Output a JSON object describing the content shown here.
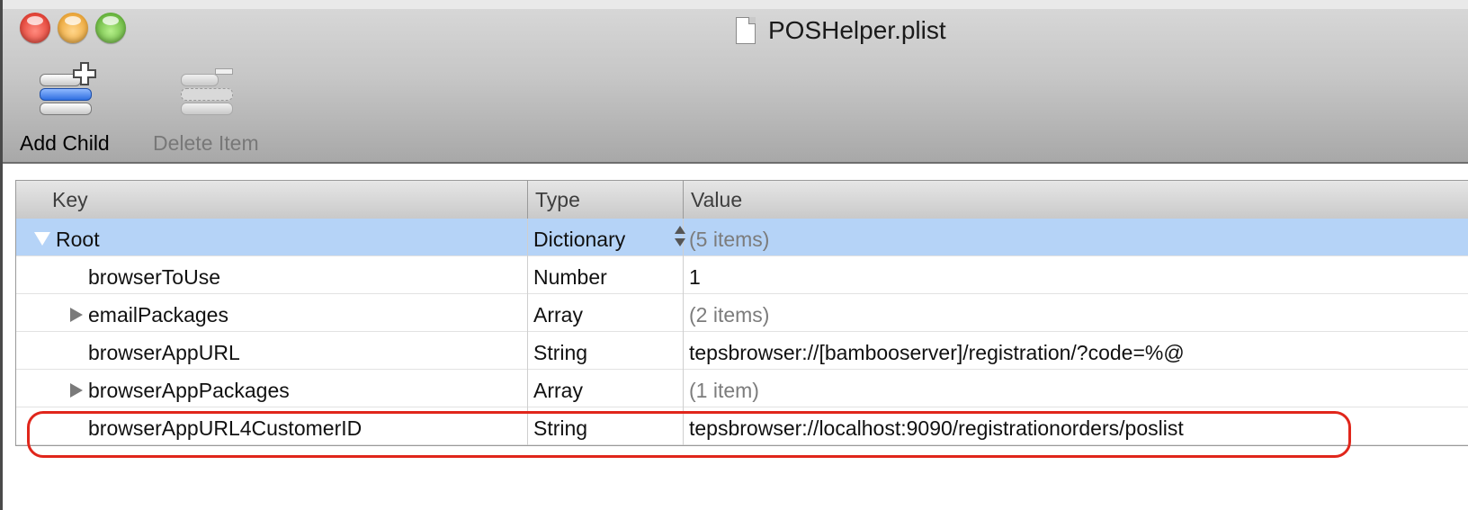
{
  "window": {
    "title": "POSHelper.plist"
  },
  "toolbar": {
    "add_child_label": "Add Child",
    "delete_item_label": "Delete Item"
  },
  "table": {
    "headers": {
      "key": "Key",
      "type": "Type",
      "value": "Value"
    },
    "rows": [
      {
        "key": "Root",
        "type": "Dictionary",
        "value": "(5 items)"
      },
      {
        "key": "browserToUse",
        "type": "Number",
        "value": "1"
      },
      {
        "key": "emailPackages",
        "type": "Array",
        "value": "(2 items)"
      },
      {
        "key": "browserAppURL",
        "type": "String",
        "value": "tepsbrowser://[bambooserver]/registration/?code=%@"
      },
      {
        "key": "browserAppPackages",
        "type": "Array",
        "value": "(1 item)"
      },
      {
        "key": "browserAppURL4CustomerID",
        "type": "String",
        "value": "tepsbrowser://localhost:9090/registrationorders/poslist"
      }
    ]
  },
  "colors": {
    "selection": "#b5d3f7",
    "annotation_outline": "#e0261b",
    "add_icon_accent": "#2f6fe0"
  }
}
